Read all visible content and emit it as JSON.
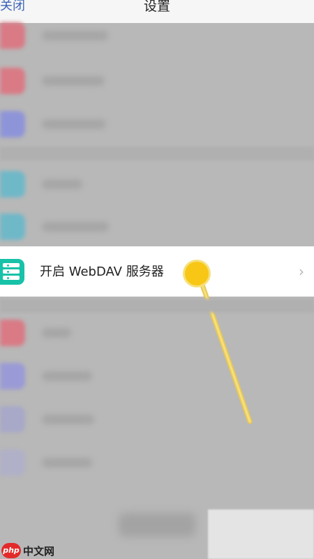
{
  "nav": {
    "close_label": "关闭",
    "title": "设置"
  },
  "blurred_rows": [
    {
      "icon_color": "#d97a85"
    },
    {
      "icon_color": "#d97a85"
    },
    {
      "icon_color": "#8e94d8"
    },
    {
      "icon_color": "#6fb8c8"
    },
    {
      "icon_color": "#6fb8c8"
    },
    {
      "icon_color": "#d97a85"
    },
    {
      "icon_color": "#9a9ad6"
    },
    {
      "icon_color": "#a8a8c8"
    },
    {
      "icon_color": "#b0b0c8"
    }
  ],
  "highlight_item": {
    "label": "开启 WebDAV 服务器",
    "icon": "server-icon",
    "icon_color": "#17c2a8",
    "chevron": "›"
  },
  "tap_indicator": {
    "color": "#f8c715"
  },
  "watermark": {
    "badge": "php",
    "text": "中文网"
  }
}
